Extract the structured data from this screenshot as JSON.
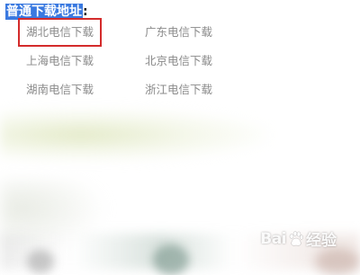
{
  "header": {
    "title": "普通下载地址",
    "colon": ":"
  },
  "links": [
    {
      "label": "湖北电信下载",
      "selected": true
    },
    {
      "label": "广东电信下载",
      "selected": false
    },
    {
      "label": "上海电信下载",
      "selected": false
    },
    {
      "label": "北京电信下载",
      "selected": false
    },
    {
      "label": "湖南电信下载",
      "selected": false
    },
    {
      "label": "浙江电信下载",
      "selected": false
    }
  ],
  "watermark": {
    "brand_text": "Bai",
    "product_text": "经验",
    "icon": "baidu-paw-icon"
  },
  "colors": {
    "header_highlight": "#3a79e0",
    "link_text": "#8a8a8a",
    "selection_outline": "#d42b2b"
  }
}
